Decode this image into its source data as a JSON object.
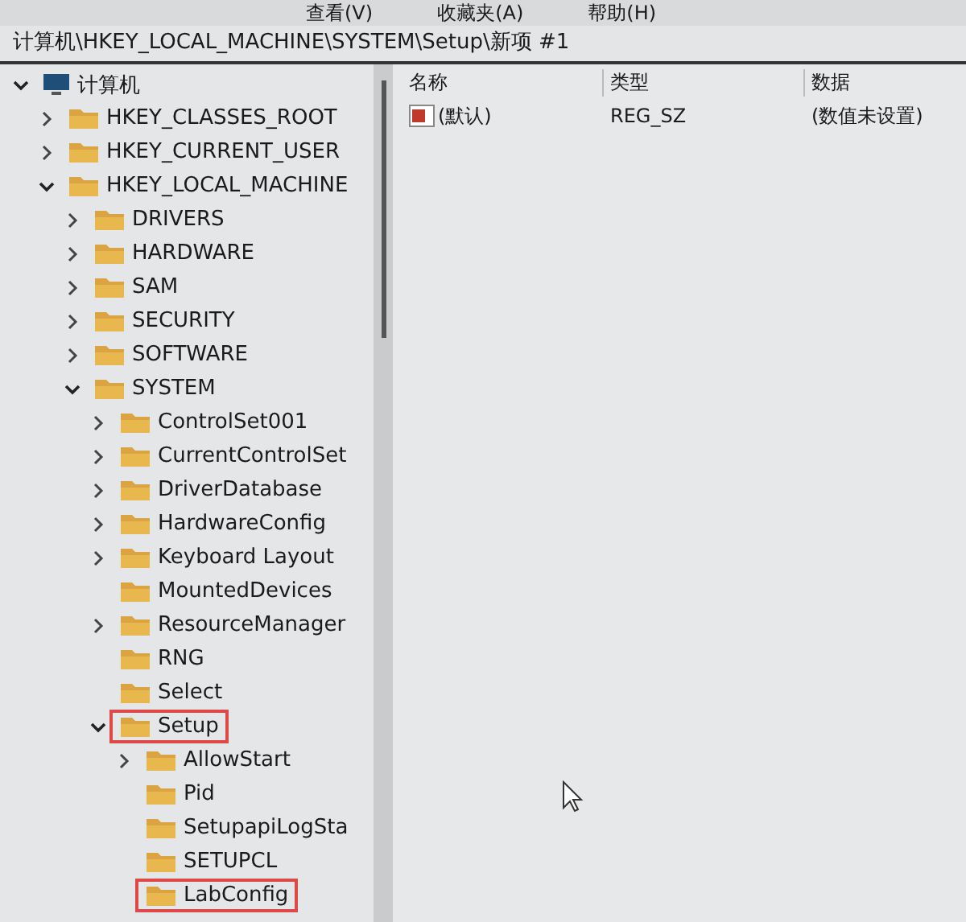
{
  "menu": [
    "查看(V)",
    "收藏夹(A)",
    "帮助(H)"
  ],
  "address": "计算机\\HKEY_LOCAL_MACHINE\\SYSTEM\\Setup\\新项 #1",
  "tree": [
    {
      "label": "计算机",
      "kind": "computer",
      "expanded": true,
      "highlighted": false,
      "children": [
        {
          "label": "HKEY_CLASSES_ROOT",
          "kind": "folder",
          "expanded": false,
          "highlighted": false
        },
        {
          "label": "HKEY_CURRENT_USER",
          "kind": "folder",
          "expanded": false,
          "highlighted": false
        },
        {
          "label": "HKEY_LOCAL_MACHINE",
          "kind": "folder",
          "expanded": true,
          "highlighted": false,
          "children": [
            {
              "label": "DRIVERS",
              "kind": "folder",
              "expanded": false,
              "highlighted": false
            },
            {
              "label": "HARDWARE",
              "kind": "folder",
              "expanded": false,
              "highlighted": false
            },
            {
              "label": "SAM",
              "kind": "folder",
              "expanded": false,
              "highlighted": false
            },
            {
              "label": "SECURITY",
              "kind": "folder",
              "expanded": false,
              "highlighted": false
            },
            {
              "label": "SOFTWARE",
              "kind": "folder",
              "expanded": false,
              "highlighted": false
            },
            {
              "label": "SYSTEM",
              "kind": "folder",
              "expanded": true,
              "highlighted": false,
              "children": [
                {
                  "label": "ControlSet001",
                  "kind": "folder",
                  "expanded": false,
                  "highlighted": false
                },
                {
                  "label": "CurrentControlSet",
                  "kind": "folder",
                  "expanded": false,
                  "highlighted": false
                },
                {
                  "label": "DriverDatabase",
                  "kind": "folder",
                  "expanded": false,
                  "highlighted": false
                },
                {
                  "label": "HardwareConfig",
                  "kind": "folder",
                  "expanded": false,
                  "highlighted": false
                },
                {
                  "label": "Keyboard Layout",
                  "kind": "folder",
                  "expanded": false,
                  "highlighted": false
                },
                {
                  "label": "MountedDevices",
                  "kind": "folder",
                  "highlighted": false
                },
                {
                  "label": "ResourceManager",
                  "kind": "folder",
                  "expanded": false,
                  "highlighted": false
                },
                {
                  "label": "RNG",
                  "kind": "folder",
                  "highlighted": false
                },
                {
                  "label": "Select",
                  "kind": "folder",
                  "highlighted": false
                },
                {
                  "label": "Setup",
                  "kind": "folder",
                  "expanded": true,
                  "highlighted": true,
                  "children": [
                    {
                      "label": "AllowStart",
                      "kind": "folder",
                      "expanded": false,
                      "highlighted": false
                    },
                    {
                      "label": "Pid",
                      "kind": "folder",
                      "highlighted": false
                    },
                    {
                      "label": "SetupapiLogSta",
                      "kind": "folder",
                      "highlighted": false
                    },
                    {
                      "label": "SETUPCL",
                      "kind": "folder",
                      "highlighted": false
                    },
                    {
                      "label": "LabConfig",
                      "kind": "folder",
                      "highlighted": true
                    }
                  ]
                }
              ]
            }
          ]
        }
      ]
    }
  ],
  "columns": [
    "名称",
    "类型",
    "数据"
  ],
  "rows": [
    {
      "name": "(默认)",
      "type": "REG_SZ",
      "data": "(数值未设置)"
    }
  ]
}
